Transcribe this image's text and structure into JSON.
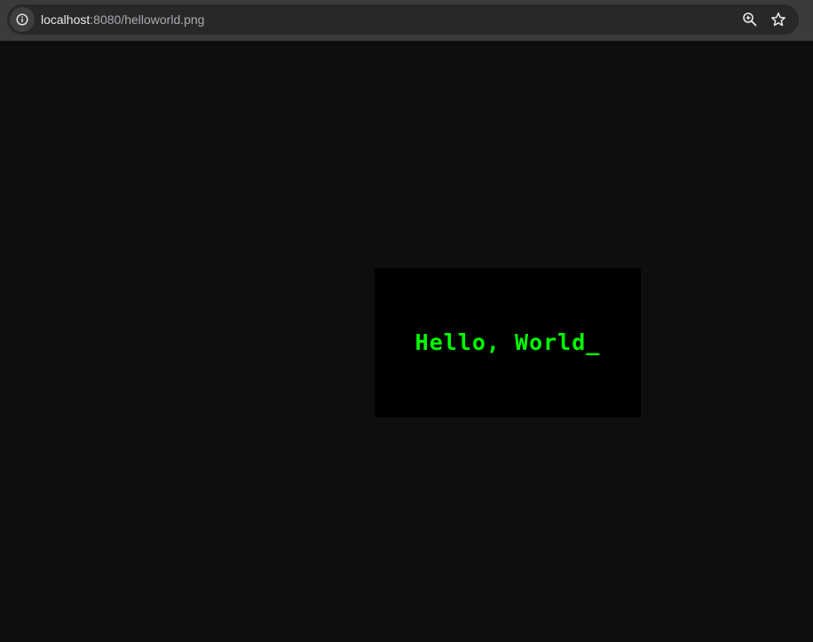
{
  "browser": {
    "url_host": "localhost",
    "url_rest": ":8080/helloworld.png",
    "icons": {
      "site_info": "info-icon",
      "zoom": "zoom-in-icon",
      "bookmark": "star-icon"
    }
  },
  "image": {
    "text": "Hello, World_",
    "text_color": "#00ff00",
    "background_color": "#000000"
  },
  "colors": {
    "page_background": "#0e0e0e",
    "toolbar_background": "#3b3b3b",
    "omnibox_background": "#282828"
  }
}
